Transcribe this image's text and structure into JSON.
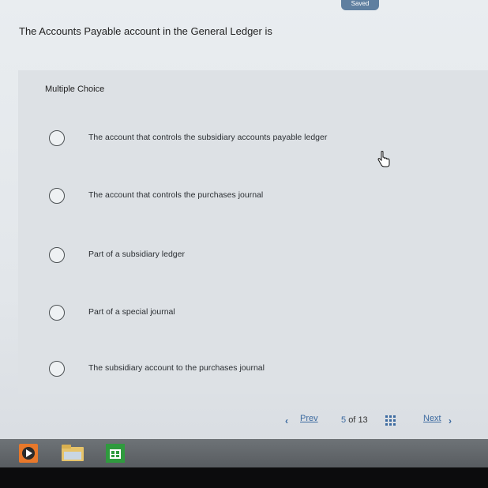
{
  "status": {
    "saved_label": "Saved"
  },
  "question": {
    "text": "The Accounts Payable account in the General Ledger is"
  },
  "answer_type": "Multiple Choice",
  "options": [
    {
      "text": "The account that controls the subsidiary accounts payable ledger"
    },
    {
      "text": "The account that controls the purchases journal"
    },
    {
      "text": "Part of a subsidiary ledger"
    },
    {
      "text": "Part of a special journal"
    },
    {
      "text": "The subsidiary account to the purchases journal"
    }
  ],
  "pagination": {
    "prev_label": "Prev",
    "current": "5",
    "of_label": "of",
    "total": "13",
    "next_label": "Next"
  },
  "icons": {
    "cursor": "hand-pointer-icon",
    "prev": "chevron-left-icon",
    "next": "chevron-right-icon",
    "overview": "grid-icon"
  },
  "taskbar": {
    "apps": [
      "media-player-icon",
      "file-explorer-icon",
      "store-icon"
    ]
  },
  "colors": {
    "accent": "#3c6aa0",
    "badge": "#5f7fa0"
  }
}
